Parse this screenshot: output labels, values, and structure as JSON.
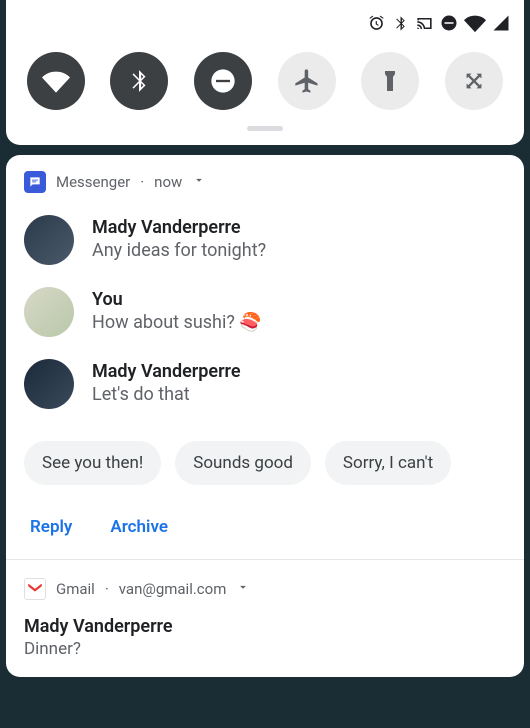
{
  "status": {
    "icons": [
      "alarm",
      "bluetooth",
      "cast",
      "dnd",
      "wifi",
      "signal"
    ]
  },
  "quick_settings": {
    "tiles": [
      {
        "name": "wifi",
        "active": true
      },
      {
        "name": "bluetooth",
        "active": true
      },
      {
        "name": "dnd",
        "active": true
      },
      {
        "name": "airplane",
        "active": false
      },
      {
        "name": "flashlight",
        "active": false
      },
      {
        "name": "autorotate",
        "active": false
      }
    ]
  },
  "messenger": {
    "app": "Messenger",
    "time": "now",
    "messages": [
      {
        "sender": "Mady Vanderperre",
        "text": "Any ideas for tonight?"
      },
      {
        "sender": "You",
        "text": "How about sushi? 🍣"
      },
      {
        "sender": "Mady Vanderperre",
        "text": "Let's do that"
      }
    ],
    "suggestions": [
      "See you then!",
      "Sounds good",
      "Sorry, I can't"
    ],
    "actions": [
      "Reply",
      "Archive"
    ]
  },
  "gmail": {
    "app": "Gmail",
    "account": "van@gmail.com",
    "sender": "Mady Vanderperre",
    "subject": "Dinner?"
  }
}
